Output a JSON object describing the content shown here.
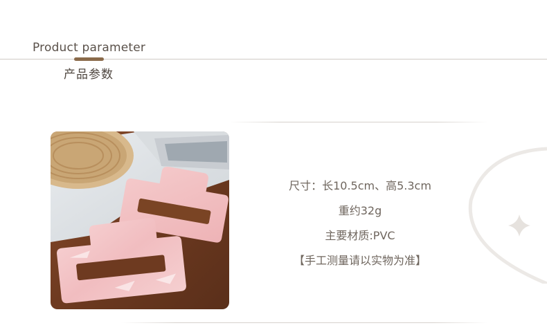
{
  "section": {
    "title": "Product parameter",
    "subtitle": "产品参数"
  },
  "specs": [
    "尺寸：长10.5cm、高5.3cm",
    "重约32g",
    "主要材质:PVC",
    "【手工测量请以实物为准】"
  ],
  "colors": {
    "accent": "#8a6a4a",
    "text": "#6f665e",
    "rule": "#d6d1cc",
    "claw_pink": "#f3c2c4"
  },
  "icons": {
    "sparkle": "four-point-star"
  }
}
